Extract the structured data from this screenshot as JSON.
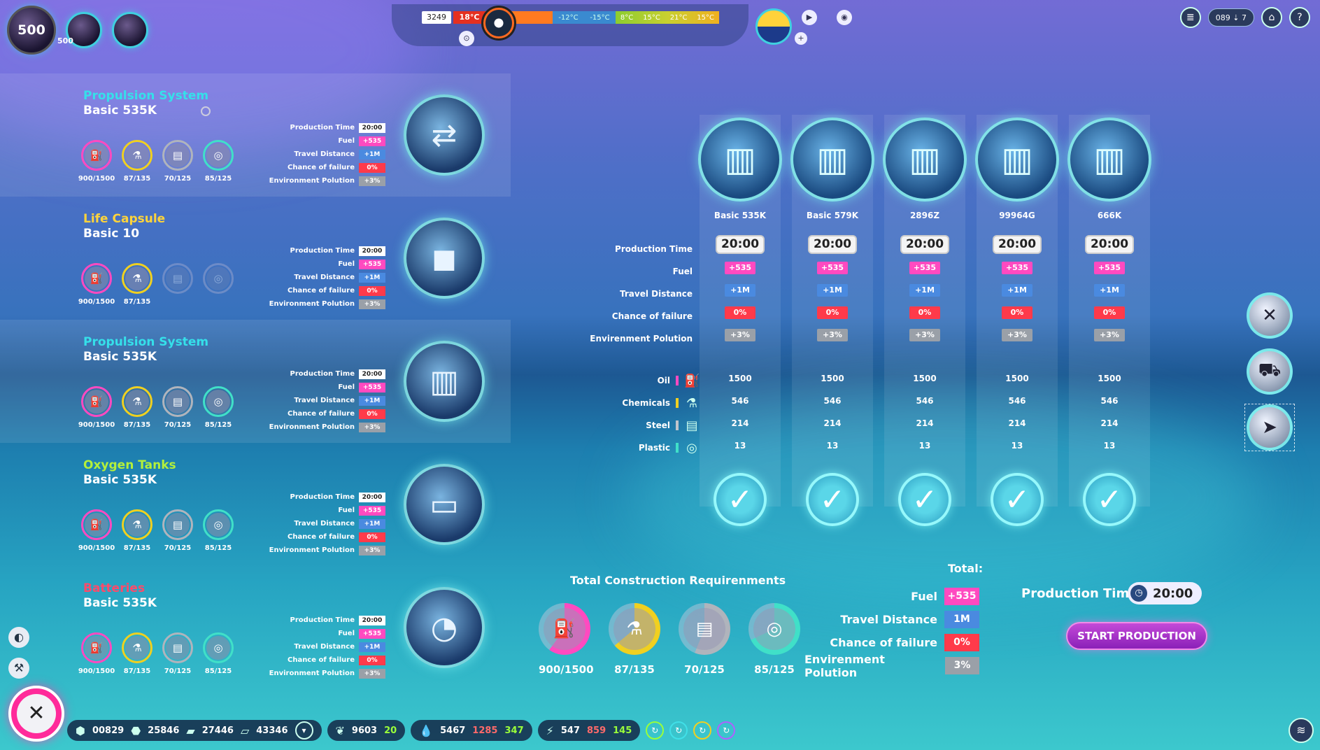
{
  "player": {
    "level": "500",
    "level_sub": "500"
  },
  "weather": {
    "count": "3249",
    "current_temp": "18°C",
    "cold_temps": [
      "-12°C",
      "-15°C"
    ],
    "warm_temps": [
      "8°C",
      "15°C",
      "21°C",
      "15°C"
    ]
  },
  "top_right": {
    "pill": "089 ⇣ 7",
    "help": "?"
  },
  "components": [
    {
      "title": "Propulsion System",
      "title_color": "#35e0ea",
      "subtitle": "Basic 535K",
      "icon": "engine-icon",
      "glyph": "⇄",
      "selected": true,
      "has_info": true,
      "resources": [
        {
          "name": "oil",
          "value": "900/1500",
          "color": "#ff4ac0",
          "glyph": "⛽"
        },
        {
          "name": "chemicals",
          "value": "87/135",
          "color": "#f0d020",
          "glyph": "⚗"
        },
        {
          "name": "steel",
          "value": "70/125",
          "color": "#b0b4bc",
          "glyph": "▤"
        },
        {
          "name": "plastic",
          "value": "85/125",
          "color": "#40e0c8",
          "glyph": "◎"
        }
      ],
      "stats": [
        {
          "label": "Production Time",
          "value": "20:00",
          "style": "v-white"
        },
        {
          "label": "Fuel",
          "value": "+535",
          "style": "v-pink"
        },
        {
          "label": "Travel Distance",
          "value": "+1M",
          "style": "v-blue"
        },
        {
          "label": "Chance of failure",
          "value": "0%",
          "style": "v-red"
        },
        {
          "label": "Environment Polution",
          "value": "+3%",
          "style": "v-gray"
        }
      ]
    },
    {
      "title": "Life Capsule",
      "title_color": "#ffd43a",
      "subtitle": "Basic 10",
      "icon": "capsule-icon",
      "glyph": "◼",
      "selected": false,
      "has_info": false,
      "resources": [
        {
          "name": "oil",
          "value": "900/1500",
          "color": "#ff4ac0",
          "glyph": "⛽"
        },
        {
          "name": "chemicals",
          "value": "87/135",
          "color": "#f0d020",
          "glyph": "⚗"
        },
        {
          "name": "steel",
          "value": "",
          "color": "transparent",
          "glyph": "▤"
        },
        {
          "name": "plastic",
          "value": "",
          "color": "transparent",
          "glyph": "◎"
        }
      ],
      "stats": [
        {
          "label": "Production Time",
          "value": "20:00",
          "style": "v-white"
        },
        {
          "label": "Fuel",
          "value": "+535",
          "style": "v-pink"
        },
        {
          "label": "Travel Distance",
          "value": "+1M",
          "style": "v-blue"
        },
        {
          "label": "Chance of failure",
          "value": "0%",
          "style": "v-red"
        },
        {
          "label": "Environment Polution",
          "value": "+3%",
          "style": "v-gray"
        }
      ]
    },
    {
      "title": "Propulsion System",
      "title_color": "#35e0ea",
      "subtitle": "Basic 535K",
      "icon": "fuel-tank-icon",
      "glyph": "▥",
      "selected": true,
      "has_info": false,
      "resources": [
        {
          "name": "oil",
          "value": "900/1500",
          "color": "#ff4ac0",
          "glyph": "⛽"
        },
        {
          "name": "chemicals",
          "value": "87/135",
          "color": "#f0d020",
          "glyph": "⚗"
        },
        {
          "name": "steel",
          "value": "70/125",
          "color": "#b0b4bc",
          "glyph": "▤"
        },
        {
          "name": "plastic",
          "value": "85/125",
          "color": "#40e0c8",
          "glyph": "◎"
        }
      ],
      "stats": [
        {
          "label": "Production Time",
          "value": "20:00",
          "style": "v-white"
        },
        {
          "label": "Fuel",
          "value": "+535",
          "style": "v-pink"
        },
        {
          "label": "Travel Distance",
          "value": "+1M",
          "style": "v-blue"
        },
        {
          "label": "Chance of failure",
          "value": "0%",
          "style": "v-red"
        },
        {
          "label": "Environment Polution",
          "value": "+3%",
          "style": "v-gray"
        }
      ]
    },
    {
      "title": "Oxygen Tanks",
      "title_color": "#b4f03a",
      "subtitle": "Basic 535K",
      "icon": "oxygen-tank-icon",
      "glyph": "▭",
      "selected": false,
      "has_info": false,
      "resources": [
        {
          "name": "oil",
          "value": "900/1500",
          "color": "#ff4ac0",
          "glyph": "⛽"
        },
        {
          "name": "chemicals",
          "value": "87/135",
          "color": "#f0d020",
          "glyph": "⚗"
        },
        {
          "name": "steel",
          "value": "70/125",
          "color": "#b0b4bc",
          "glyph": "▤"
        },
        {
          "name": "plastic",
          "value": "85/125",
          "color": "#40e0c8",
          "glyph": "◎"
        }
      ],
      "stats": [
        {
          "label": "Production Time",
          "value": "20:00",
          "style": "v-white"
        },
        {
          "label": "Fuel",
          "value": "+535",
          "style": "v-pink"
        },
        {
          "label": "Travel Distance",
          "value": "+1M",
          "style": "v-blue"
        },
        {
          "label": "Chance of failure",
          "value": "0%",
          "style": "v-red"
        },
        {
          "label": "Environment Polution",
          "value": "+3%",
          "style": "v-gray"
        }
      ]
    },
    {
      "title": "Batteries",
      "title_color": "#ff4a6a",
      "subtitle": "Basic 535K",
      "icon": "battery-icon",
      "glyph": "◔",
      "selected": false,
      "has_info": false,
      "resources": [
        {
          "name": "oil",
          "value": "900/1500",
          "color": "#ff4ac0",
          "glyph": "⛽"
        },
        {
          "name": "chemicals",
          "value": "87/135",
          "color": "#f0d020",
          "glyph": "⚗"
        },
        {
          "name": "steel",
          "value": "70/125",
          "color": "#b0b4bc",
          "glyph": "▤"
        },
        {
          "name": "plastic",
          "value": "85/125",
          "color": "#40e0c8",
          "glyph": "◎"
        }
      ],
      "stats": [
        {
          "label": "Production Time",
          "value": "20:00",
          "style": "v-white"
        },
        {
          "label": "Fuel",
          "value": "+535",
          "style": "v-pink"
        },
        {
          "label": "Travel Distance",
          "value": "+1M",
          "style": "v-blue"
        },
        {
          "label": "Chance of failure",
          "value": "0%",
          "style": "v-red"
        },
        {
          "label": "Environment Polution",
          "value": "+3%",
          "style": "v-gray"
        }
      ]
    }
  ],
  "grid": {
    "row_labels": [
      "Production Time",
      "Fuel",
      "Travel Distance",
      "Chance of failure",
      "Envirenment Polution"
    ],
    "material_labels": [
      {
        "label": "Oil",
        "color": "#ff4ac0",
        "icon": "oil-icon",
        "glyph": "⛽"
      },
      {
        "label": "Chemicals",
        "color": "#f0d020",
        "icon": "chemicals-icon",
        "glyph": "⚗"
      },
      {
        "label": "Steel",
        "color": "#c0c4cc",
        "icon": "steel-icon",
        "glyph": "▤"
      },
      {
        "label": "Plastic",
        "color": "#40e0c8",
        "icon": "plastic-icon",
        "glyph": "◎"
      }
    ],
    "options": [
      {
        "name": "Basic 535K",
        "time": "20:00",
        "fuel": "+535",
        "distance": "+1M",
        "failure": "0%",
        "pollution": "+3%",
        "oil": "1500",
        "chemicals": "546",
        "steel": "214",
        "plastic": "13"
      },
      {
        "name": "Basic 579K",
        "time": "20:00",
        "fuel": "+535",
        "distance": "+1M",
        "failure": "0%",
        "pollution": "+3%",
        "oil": "1500",
        "chemicals": "546",
        "steel": "214",
        "plastic": "13"
      },
      {
        "name": "2896Z",
        "time": "20:00",
        "fuel": "+535",
        "distance": "+1M",
        "failure": "0%",
        "pollution": "+3%",
        "oil": "1500",
        "chemicals": "546",
        "steel": "214",
        "plastic": "13"
      },
      {
        "name": "99964G",
        "time": "20:00",
        "fuel": "+535",
        "distance": "+1M",
        "failure": "0%",
        "pollution": "+3%",
        "oil": "1500",
        "chemicals": "546",
        "steel": "214",
        "plastic": "13"
      },
      {
        "name": "666K",
        "time": "20:00",
        "fuel": "+535",
        "distance": "+1M",
        "failure": "0%",
        "pollution": "+3%",
        "oil": "1500",
        "chemicals": "546",
        "steel": "214",
        "plastic": "13"
      }
    ]
  },
  "totals": {
    "title": "Total Construction Requirenments",
    "items": [
      {
        "name": "oil",
        "value": "900/1500",
        "color": "#ff4ac0",
        "fraction": 0.6,
        "glyph": "⛽"
      },
      {
        "name": "chemicals",
        "value": "87/135",
        "color": "#f0d020",
        "fraction": 0.64,
        "glyph": "⚗"
      },
      {
        "name": "steel",
        "value": "70/125",
        "color": "#b0b4bc",
        "fraction": 0.56,
        "glyph": "▤"
      },
      {
        "name": "plastic",
        "value": "85/125",
        "color": "#40e0c8",
        "fraction": 0.68,
        "glyph": "◎"
      }
    ]
  },
  "summary": {
    "title": "Total:",
    "rows": [
      {
        "label": "Fuel",
        "value": "+535",
        "style": "v-pink"
      },
      {
        "label": "Travel Distance",
        "value": "1M",
        "style": "v-blue"
      },
      {
        "label": "Chance of failure",
        "value": "0%",
        "style": "v-red"
      },
      {
        "label": "Envirenment Polution",
        "value": "3%",
        "style": "v-gray"
      }
    ],
    "production_time_label": "Production Time",
    "production_time": "20:00",
    "start_label": "START PRODUCTION"
  },
  "bottom_bar": {
    "materials": [
      "00829",
      "25846",
      "27446",
      "43346"
    ],
    "food": "9603",
    "food_delta": "20",
    "water": "5467",
    "water_down": "1285",
    "water_up": "347",
    "energy": "547",
    "energy_down": "859",
    "energy_up": "145"
  },
  "close_label": "✕"
}
